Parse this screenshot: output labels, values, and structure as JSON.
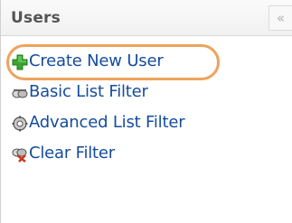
{
  "panel": {
    "title": "Users",
    "collapse_glyph": "«"
  },
  "menu": {
    "items": [
      {
        "label": "Create New User",
        "icon": "add-user-icon",
        "highlighted": true
      },
      {
        "label": "Basic List Filter",
        "icon": "filter-icon"
      },
      {
        "label": "Advanced List Filter",
        "icon": "gear-filter-icon"
      },
      {
        "label": "Clear Filter",
        "icon": "clear-filter-icon"
      }
    ]
  },
  "colors": {
    "link": "#154c9d",
    "highlight": "#eea35c",
    "add_icon": "#3aa530"
  }
}
